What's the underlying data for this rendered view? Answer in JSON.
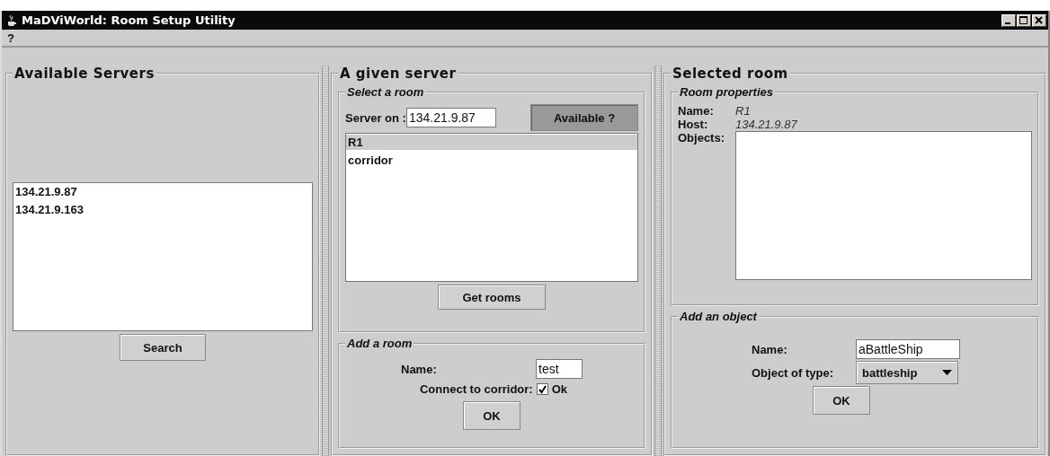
{
  "window": {
    "title": "MaDViWorld: Room Setup Utility"
  },
  "menu": [
    {
      "label": "?"
    }
  ],
  "servers_panel": {
    "title": "Available Servers",
    "servers": [
      {
        "label": "134.21.9.87",
        "selected": false
      },
      {
        "label": "134.21.9.163",
        "selected": false
      }
    ],
    "search_button": "Search"
  },
  "server_panel": {
    "title": "A given server",
    "select_room": {
      "title": "Select a room",
      "server_label": "Server on :",
      "server_value": "134.21.9.87",
      "available_button": {
        "label": "Available ?",
        "pressed": true
      },
      "rooms": [
        {
          "label": "R1",
          "selected": true
        },
        {
          "label": "corridor",
          "selected": false
        }
      ],
      "get_rooms_button": "Get rooms"
    },
    "add_room": {
      "title": "Add a room",
      "name_label": "Name:",
      "name_value": "test",
      "connect_label": "Connect to corridor:",
      "connect_checked": true,
      "checkbox_label": "Ok",
      "ok_button": "OK"
    }
  },
  "room_panel": {
    "title": "Selected room",
    "properties": {
      "title": "Room properties",
      "name_label": "Name:",
      "name_value": "R1",
      "host_label": "Host:",
      "host_value": "134.21.9.87",
      "objects_label": "Objects:"
    },
    "add_object": {
      "title": "Add an object",
      "name_label": "Name:",
      "name_value": "aBattleShip",
      "type_label": "Object of type:",
      "type_value": "battleship",
      "ok_button": "OK"
    }
  }
}
